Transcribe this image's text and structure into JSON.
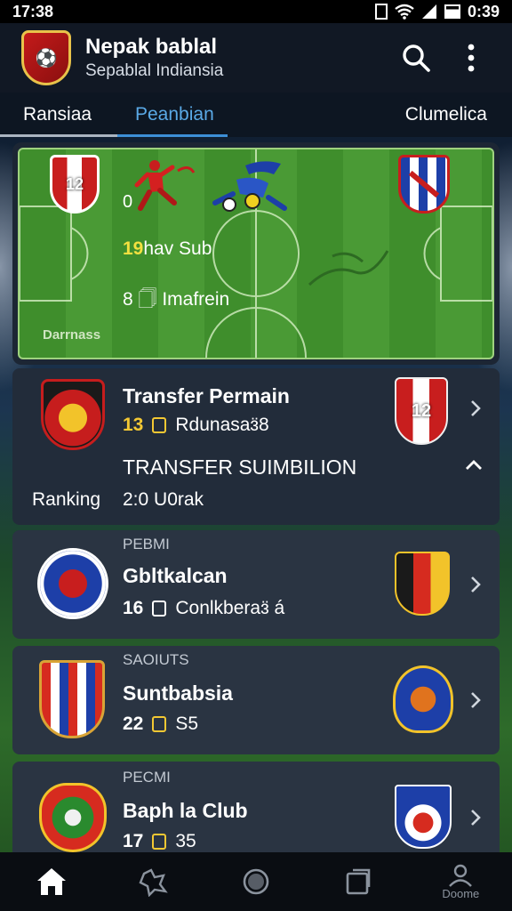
{
  "status": {
    "time": "17:38",
    "clock": "0:39"
  },
  "header": {
    "title": "Nepak bablal",
    "subtitle": "Sepablal Indiansia"
  },
  "tabs": [
    {
      "label": "Ransiaa"
    },
    {
      "label": "Peanbian"
    },
    {
      "label": "Clumelica"
    }
  ],
  "match": {
    "home_crest_text": "12",
    "score_left": "0",
    "line1_num": "19",
    "line1_text": "hav Sub",
    "line2": "8 🗍 Imafrein",
    "footer_label": "Darrnass"
  },
  "expanded_card": {
    "title": "Transfer Permain",
    "meta_num": "13",
    "meta_text": "Rdunasaɜ̈8",
    "subheader": "TRANSFER SUIMBILION",
    "ranking_label": "Ranking",
    "ranking_value": "2:0 U0rak",
    "right_crest_text": "12"
  },
  "rows": [
    {
      "caption": "PEBMI",
      "title": "Gbltkalcan",
      "num": "16",
      "text": "Conlkberaɜ̈ á"
    },
    {
      "caption": "SAOIUTS",
      "title": "Suntbabsia",
      "num": "22",
      "text": "S5"
    },
    {
      "caption": "PECMI",
      "title": "Baph la Club",
      "num": "17",
      "text": "35"
    }
  ],
  "nav": [
    {
      "icon": "home-icon",
      "label": ""
    },
    {
      "icon": "whistle-icon",
      "label": ""
    },
    {
      "icon": "ball-icon",
      "label": ""
    },
    {
      "icon": "cards-icon",
      "label": ""
    },
    {
      "icon": "profile-icon",
      "label": "Doome"
    }
  ],
  "colors": {
    "accent": "#3d8fd6",
    "highlight": "#f3c833",
    "card": "#2a3442",
    "header": "#111824"
  }
}
